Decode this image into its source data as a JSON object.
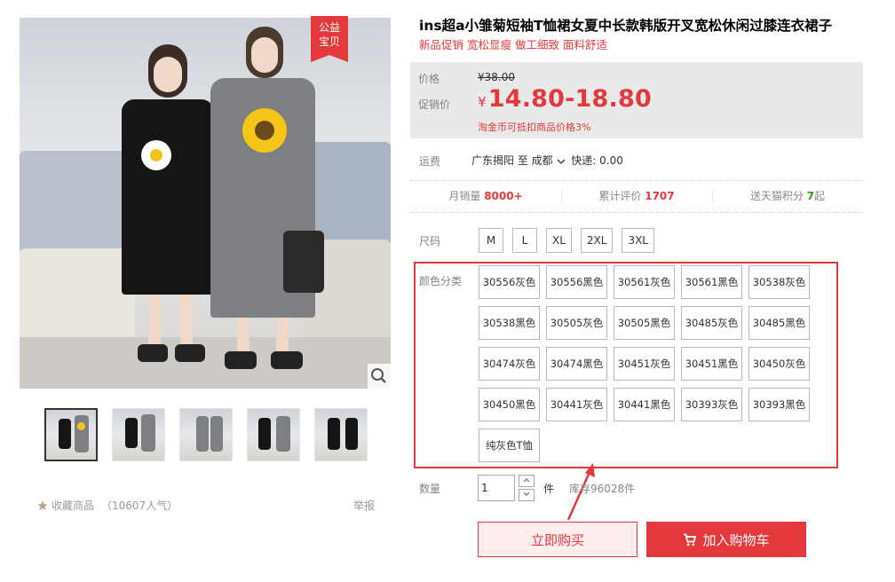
{
  "gallery": {
    "badge": "公益宝贝",
    "thumb_count": 5,
    "fav_label": "收藏商品",
    "fav_count": "（10607人气）",
    "report_label": "举报"
  },
  "product": {
    "title": "ins超a小雏菊短袖T恤裙女夏中长款韩版开叉宽松休闲过膝连衣裙子",
    "subtitle": "新品促销 宽松显瘦 做工细致 面料舒适"
  },
  "price": {
    "original_label": "价格",
    "original_value": "¥38.00",
    "promo_label": "促销价",
    "currency": "¥",
    "promo_value": "14.80-18.80",
    "coin_note": "淘金币可抵扣商品价格3%"
  },
  "shipping": {
    "label": "运费",
    "text": "广东揭阳 至 成都",
    "express": "快递: 0.00"
  },
  "stats": {
    "monthly_label": "月销量",
    "monthly_value": "8000+",
    "reviews_label": "累计评价",
    "reviews_value": "1707",
    "points_label": "送天猫积分",
    "points_value": "7",
    "points_suffix": "起"
  },
  "sizes": {
    "label": "尺码",
    "options": [
      "M",
      "L",
      "XL",
      "2XL",
      "3XL"
    ]
  },
  "colors": {
    "label": "颜色分类",
    "options": [
      "30556灰色",
      "30556黑色",
      "30561灰色",
      "30561黑色",
      "30538灰色",
      "30538黑色",
      "30505灰色",
      "30505黑色",
      "30485灰色",
      "30485黑色",
      "30474灰色",
      "30474黑色",
      "30451灰色",
      "30451黑色",
      "30450灰色",
      "30450黑色",
      "30441灰色",
      "30441黑色",
      "30393灰色",
      "30393黑色",
      "纯灰色T恤"
    ]
  },
  "quantity": {
    "label": "数量",
    "value": "1",
    "unit": "件",
    "stock": "库存96028件"
  },
  "actions": {
    "buy_now": "立即购买",
    "add_to_cart": "加入购物车"
  },
  "theme": {
    "accent": "#e4393c"
  }
}
